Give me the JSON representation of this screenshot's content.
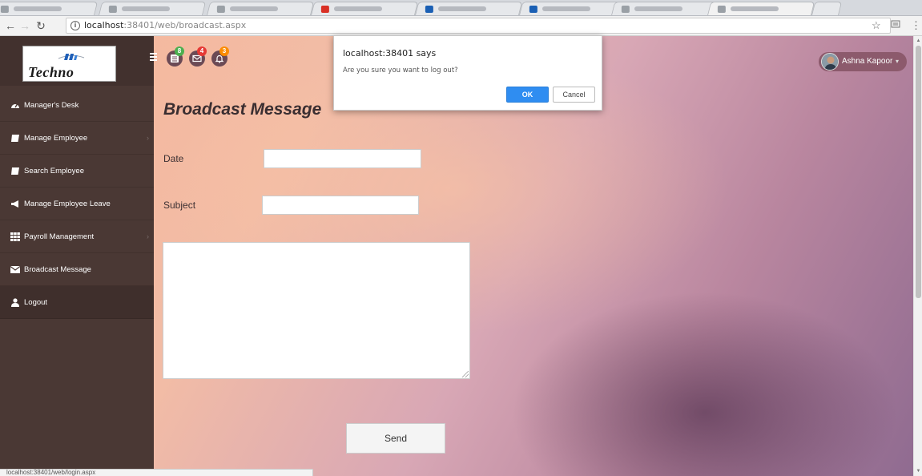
{
  "browser": {
    "url_host": "localhost",
    "url_rest": ":38401/web/broadcast.aspx",
    "status_text": "localhost:38401/web/login.aspx",
    "tab_favicon_colors": [
      "#9aa0a6",
      "#9aa0a6",
      "#9aa0a6",
      "#d93025",
      "#1a5fb4",
      "#1a5fb4",
      "#9aa0a6",
      "#9aa0a6"
    ]
  },
  "logo": {
    "text": "Techno",
    "accent_color": "#1f5fb8"
  },
  "sidebar": {
    "items": [
      {
        "label": "Manager's Desk",
        "icon": "tachometer-icon"
      },
      {
        "label": "Manage Employee",
        "icon": "book-icon"
      },
      {
        "label": "Search Employee",
        "icon": "book-icon"
      },
      {
        "label": "Manage Employee Leave",
        "icon": "bullhorn-icon"
      },
      {
        "label": "Payroll Management",
        "icon": "grid-icon"
      },
      {
        "label": "Broadcast Message",
        "icon": "envelope-icon"
      },
      {
        "label": "Logout",
        "icon": "user-icon"
      }
    ]
  },
  "header": {
    "badges": [
      {
        "count": "8",
        "color": "#4caf50",
        "icon": "list-icon"
      },
      {
        "count": "4",
        "color": "#e53935",
        "icon": "envelope-icon"
      },
      {
        "count": "3",
        "color": "#fb8c00",
        "icon": "bell-icon"
      }
    ],
    "user_name": "Ashna Kapoor",
    "user_caret": "▾"
  },
  "main": {
    "title": "Broadcast Message",
    "date_label": "Date",
    "date_value": "",
    "subject_label": "Subject",
    "subject_value": "",
    "message_value": "",
    "send_label": "Send"
  },
  "dialog": {
    "title": "localhost:38401 says",
    "message": "Are you sure you want to log out?",
    "ok_label": "OK",
    "cancel_label": "Cancel"
  }
}
